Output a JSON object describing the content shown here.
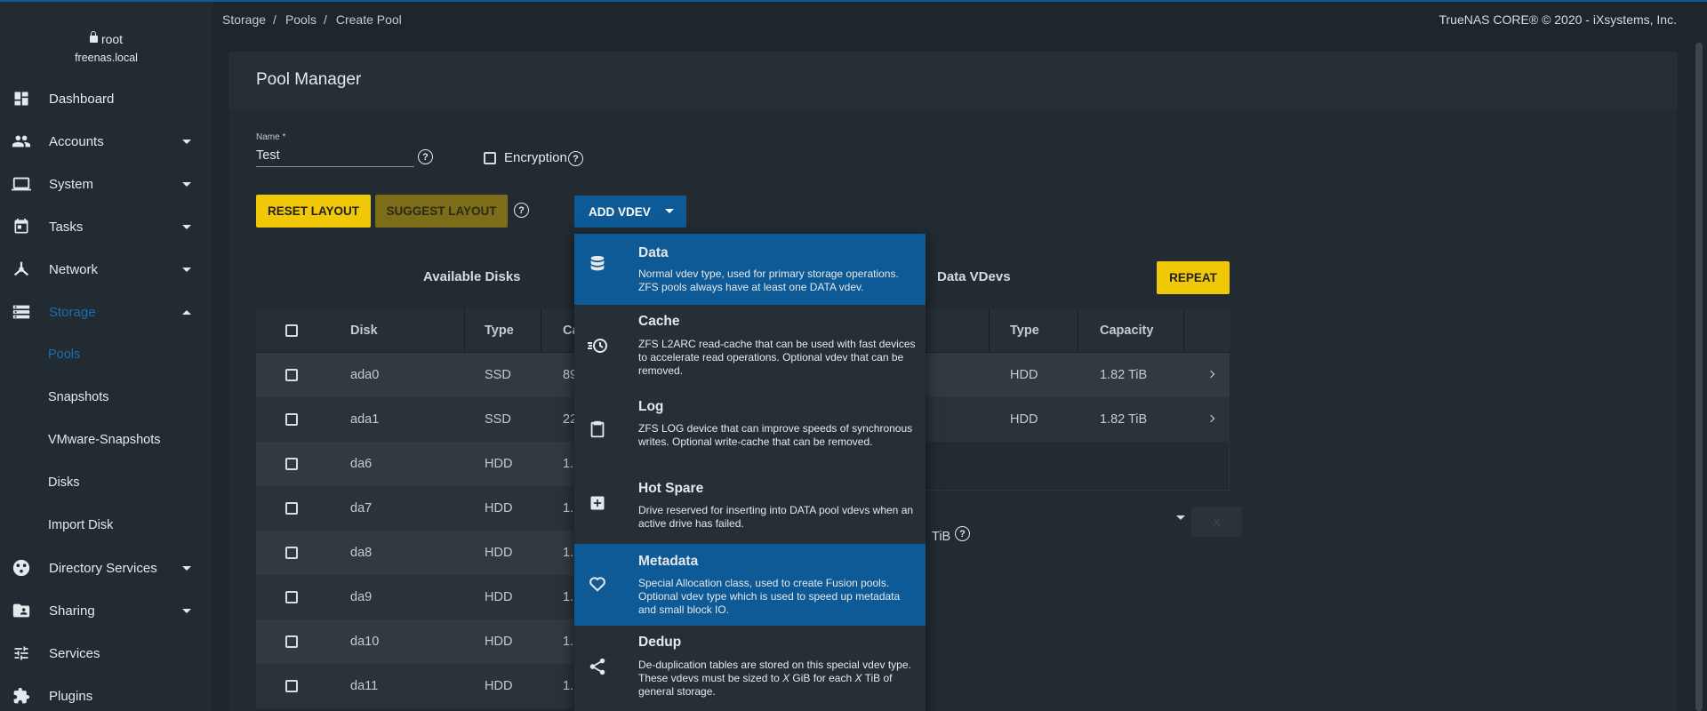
{
  "user": {
    "name": "root",
    "host": "freenas.local"
  },
  "nav": {
    "dashboard": "Dashboard",
    "accounts": "Accounts",
    "system": "System",
    "tasks": "Tasks",
    "network": "Network",
    "storage": "Storage",
    "storage_sub": [
      "Pools",
      "Snapshots",
      "VMware-Snapshots",
      "Disks",
      "Import Disk"
    ],
    "directory_services": "Directory Services",
    "sharing": "Sharing",
    "services": "Services",
    "plugins": "Plugins"
  },
  "breadcrumb": [
    "Storage",
    "Pools",
    "Create Pool"
  ],
  "copyright": "TrueNAS CORE® © 2020 - iXsystems, Inc.",
  "card": {
    "title": "Pool Manager"
  },
  "form": {
    "name_label": "Name *",
    "name_value": "Test",
    "encryption_label": "Encryption",
    "help_glyph": "?"
  },
  "buttons": {
    "reset_layout": "RESET LAYOUT",
    "suggest_layout": "SUGGEST LAYOUT",
    "add_vdev": "ADD VDEV",
    "repeat": "REPEAT"
  },
  "available_disks": {
    "title": "Available Disks",
    "columns": [
      "Disk",
      "Type",
      "Ca"
    ],
    "rows": [
      {
        "disk": "ada0",
        "type": "SSD",
        "cap": "89"
      },
      {
        "disk": "ada1",
        "type": "SSD",
        "cap": "22"
      },
      {
        "disk": "da6",
        "type": "HDD",
        "cap": "1."
      },
      {
        "disk": "da7",
        "type": "HDD",
        "cap": "1."
      },
      {
        "disk": "da8",
        "type": "HDD",
        "cap": "1."
      },
      {
        "disk": "da9",
        "type": "HDD",
        "cap": "1."
      },
      {
        "disk": "da10",
        "type": "HDD",
        "cap": "1."
      },
      {
        "disk": "da11",
        "type": "HDD",
        "cap": "1."
      }
    ]
  },
  "data_vdevs": {
    "title": "Data VDevs",
    "columns": [
      "Type",
      "Capacity"
    ],
    "rows": [
      {
        "type": "HDD",
        "capacity": "1.82 TiB"
      },
      {
        "type": "HDD",
        "capacity": "1.82 TiB"
      }
    ],
    "size_suffix": "TiB",
    "remove_glyph": "X"
  },
  "add_vdev_menu": [
    {
      "icon": "database-icon",
      "title": "Data",
      "desc": "Normal vdev type, used for primary storage operations. ZFS pools always have at least one DATA vdev.",
      "selected": true
    },
    {
      "icon": "cache-clock-icon",
      "title": "Cache",
      "desc": "ZFS L2ARC read-cache that can be used with fast devices to accelerate read operations. Optional vdev that can be removed.",
      "selected": false
    },
    {
      "icon": "clipboard-icon",
      "title": "Log",
      "desc": "ZFS LOG device that can improve speeds of synchronous writes. Optional write-cache that can be removed.",
      "selected": false
    },
    {
      "icon": "plus-box-icon",
      "title": "Hot Spare",
      "desc": "Drive reserved for inserting into DATA pool vdevs when an active drive has failed.",
      "selected": false
    },
    {
      "icon": "heart-icon",
      "title": "Metadata",
      "desc": "Special Allocation class, used to create Fusion pools. Optional vdev type which is used to speed up metadata and small block IO.",
      "selected": true
    },
    {
      "icon": "share-icon",
      "title": "Dedup",
      "desc_parts": [
        "De-duplication tables are stored on this special vdev type. These vdevs must be sized to ",
        "X",
        " GiB for each ",
        "X",
        " TiB of general storage."
      ],
      "selected": false
    }
  ],
  "colors": {
    "accent": "#0d5a96",
    "yellow": "#f0c808",
    "background": "#1e262c",
    "sidebar": "#222b31"
  }
}
